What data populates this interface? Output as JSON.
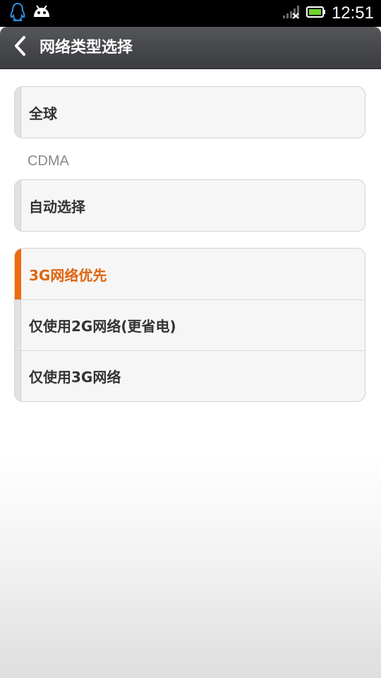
{
  "status_bar": {
    "left_icons": [
      "qq-penguin-icon",
      "android-icon"
    ],
    "right_icons": [
      "signal-strength-icon",
      "battery-icon"
    ],
    "time": "12:51"
  },
  "header": {
    "back_icon": "chevron-left-icon",
    "title": "网络类型选择"
  },
  "groups": [
    {
      "items": [
        {
          "label": "全球",
          "selected": false
        }
      ]
    },
    {
      "section_header": "CDMA",
      "items": [
        {
          "label": "自动选择",
          "selected": false
        }
      ]
    },
    {
      "items": [
        {
          "label": "3G网络优先",
          "selected": true
        },
        {
          "label": "仅使用2G网络(更省电)",
          "selected": false
        },
        {
          "label": "仅使用3G网络",
          "selected": false
        }
      ]
    }
  ],
  "colors": {
    "accent": "#ee6a10",
    "selected_text": "#e06510",
    "title_bar": "#46484b",
    "status_bar": "#000000"
  }
}
